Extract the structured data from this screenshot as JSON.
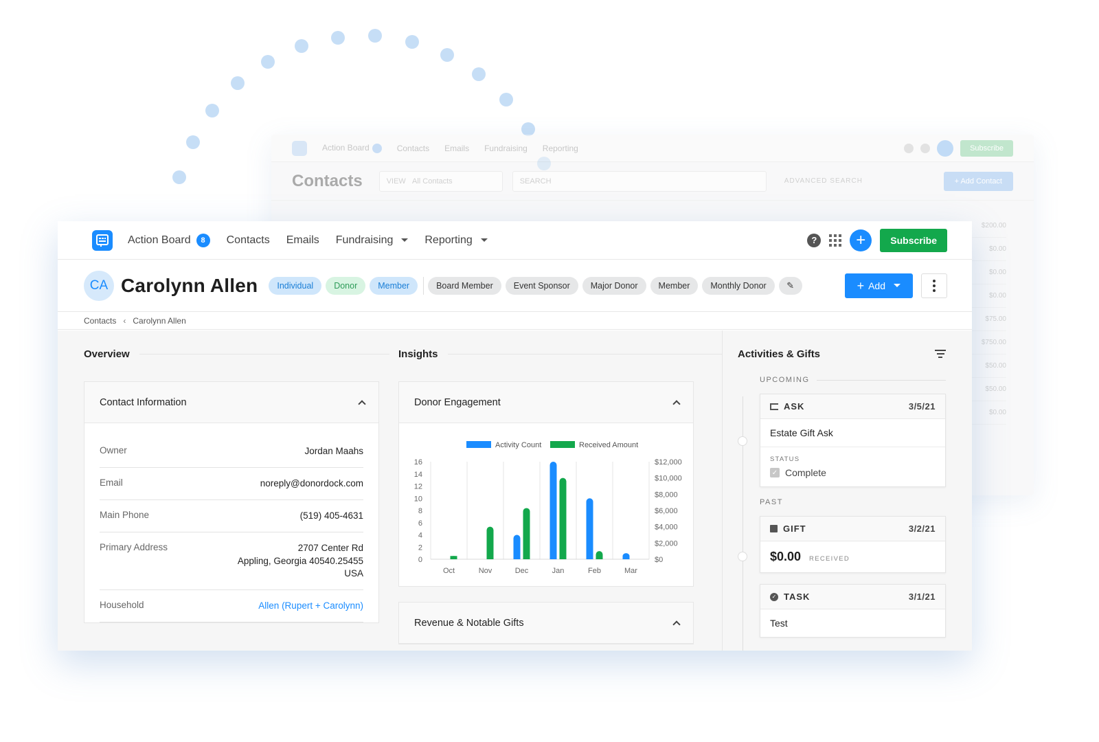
{
  "nav": {
    "action_board": "Action Board",
    "action_board_badge": "8",
    "contacts": "Contacts",
    "emails": "Emails",
    "fundraising": "Fundraising",
    "reporting": "Reporting",
    "subscribe": "Subscribe",
    "help": "?"
  },
  "contact": {
    "initials": "CA",
    "name": "Carolynn Allen",
    "tags_primary": [
      "Individual",
      "Donor",
      "Member"
    ],
    "tags_secondary": [
      "Board Member",
      "Event Sponsor",
      "Major Donor",
      "Member",
      "Monthly Donor"
    ],
    "add_label": "Add"
  },
  "breadcrumb": {
    "root": "Contacts",
    "current": "Carolynn Allen"
  },
  "overview": {
    "heading": "Overview",
    "card_title": "Contact Information",
    "rows": [
      {
        "k": "Owner",
        "v": "Jordan Maahs"
      },
      {
        "k": "Email",
        "v": "noreply@donordock.com"
      },
      {
        "k": "Main Phone",
        "v": "(519) 405-4631"
      },
      {
        "k": "Primary Address",
        "v1": "2707 Center Rd",
        "v2": "Appling, Georgia 40540.25455",
        "v3": "USA"
      },
      {
        "k": "Household",
        "v": "Allen (Rupert + Carolynn)"
      }
    ]
  },
  "insights": {
    "heading": "Insights",
    "card1_title": "Donor Engagement",
    "card2_title": "Revenue & Notable Gifts"
  },
  "chart_data": {
    "type": "bar",
    "categories": [
      "Oct",
      "Nov",
      "Dec",
      "Jan",
      "Feb",
      "Mar"
    ],
    "series": [
      {
        "name": "Activity Count",
        "color": "#1a8cff",
        "axis": "left",
        "values": [
          0,
          0,
          4,
          16,
          10,
          1
        ]
      },
      {
        "name": "Received Amount",
        "color": "#13a84c",
        "axis": "right",
        "values": [
          400,
          4000,
          6300,
          10000,
          1000,
          0
        ]
      }
    ],
    "y_left": {
      "min": 0,
      "max": 16,
      "ticks": [
        "0",
        "2",
        "4",
        "6",
        "8",
        "10",
        "12",
        "14",
        "16"
      ]
    },
    "y_right": {
      "min": 0,
      "max": 12000,
      "ticks": [
        "$0",
        "$2,000",
        "$4,000",
        "$6,000",
        "$8,000",
        "$10,000",
        "$12,000"
      ]
    },
    "legend": "top",
    "grid": "vertical"
  },
  "activities": {
    "heading": "Activities & Gifts",
    "upcoming": "UPCOMING",
    "past": "PAST",
    "items": [
      {
        "type": "ASK",
        "date": "3/5/21",
        "title": "Estate Gift Ask",
        "status_label": "STATUS",
        "status": "Complete"
      },
      {
        "type": "GIFT",
        "date": "3/2/21",
        "amount": "$0.00",
        "note": "RECEIVED"
      },
      {
        "type": "TASK",
        "date": "3/1/21",
        "title": "Test"
      }
    ]
  },
  "background_window": {
    "title": "Contacts",
    "nav": [
      "Action Board",
      "Contacts",
      "Emails",
      "Fundraising",
      "Reporting"
    ],
    "view_label": "VIEW",
    "view_value": "All Contacts",
    "search_label": "SEARCH",
    "advanced": "ADVANCED SEARCH",
    "add_contact": "+ Add Contact",
    "subscribe": "Subscribe",
    "amounts": [
      "$200.00",
      "$0.00",
      "$0.00",
      "$0.00",
      "$75.00",
      "$750.00",
      "$50.00",
      "$50.00",
      "$0.00"
    ]
  }
}
